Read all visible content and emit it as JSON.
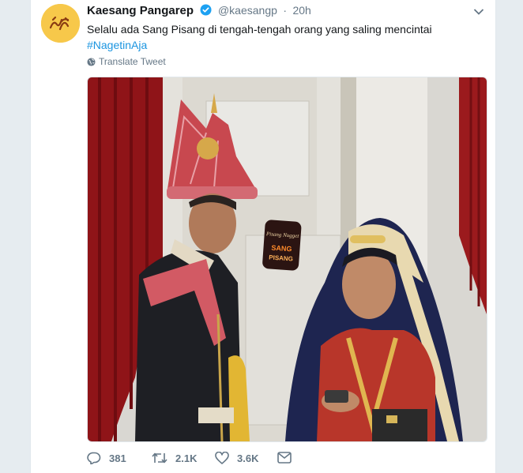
{
  "tweet": {
    "author_name": "Kaesang Pangarep",
    "handle": "@kaesangp",
    "separator": "·",
    "time": "20h",
    "text": "Selalu ada Sang Pisang di tengah-tengah orang yang saling mencintai",
    "hashtag": "#NagetinAja",
    "translate_label": "Translate Tweet"
  },
  "actions": {
    "replies": "381",
    "retweets": "2.1K",
    "likes": "3.6K"
  },
  "sticker": {
    "line1": "Pisang Nugget",
    "line2": "SANG",
    "line3": "PISANG"
  },
  "colors": {
    "accent": "#1b95e0",
    "verified": "#1da1f2",
    "avatar_bg": "#f7c84a"
  },
  "icons": [
    "caret-down-icon",
    "verified-badge-icon",
    "globe-icon",
    "reply-icon",
    "retweet-icon",
    "like-icon",
    "message-icon"
  ]
}
